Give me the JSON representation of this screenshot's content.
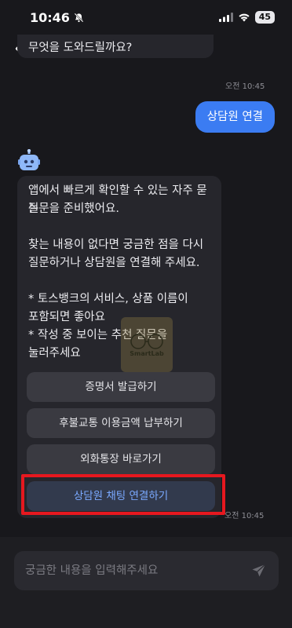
{
  "status_bar": {
    "time": "10:46",
    "battery": "45"
  },
  "chat": {
    "prev_message_tail": "무엇을 도와드릴까요?",
    "prev_time": "오전 10:45",
    "user_message": "상담원 연결",
    "bot_message_lines": [
      "앱에서 빠르게 확인할 수 있는 자주 묻는",
      "질문을 준비했어요.",
      "",
      "찾는 내용이 없다면 궁금한 점을 다시",
      "질문하거나 상담원을 연결해 주세요.",
      "",
      "* 토스뱅크의 서비스, 상품 이름이",
      "포함되면 좋아요",
      "* 작성 중 보이는 추천 질문을",
      "눌러주세요"
    ],
    "quick_buttons": [
      "증명서 발급하기",
      "후불교통 이용금액 납부하기",
      "외화통장 바로가기",
      "상담원 채팅 연결하기"
    ],
    "bot_time": "오전 10:45"
  },
  "input": {
    "placeholder": "궁금한 내용을 입력해주세요"
  },
  "watermark": {
    "text": "SmartLab"
  },
  "colors": {
    "accent": "#3b7cf2",
    "highlight": "#e6181f",
    "background": "#18181c"
  }
}
